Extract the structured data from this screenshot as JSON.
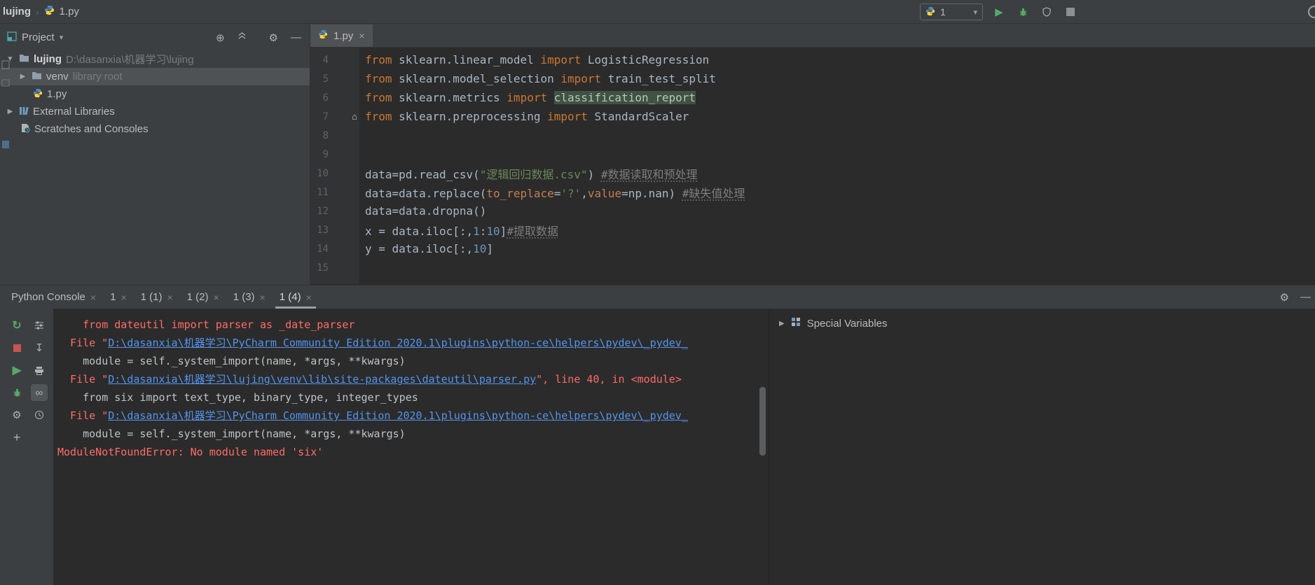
{
  "topbar": {
    "breadcrumb_project": "lujing",
    "breadcrumb_file": "1.py",
    "run_config": "1"
  },
  "icons": {
    "breadcrumb_separator": "›",
    "dropdown_caret": "▾",
    "run": "▶",
    "rerun": "↻",
    "stop": "■",
    "close": "×",
    "expanded": "▼",
    "collapsed": "▶",
    "gear": "⚙",
    "locate": "⊕",
    "minimize": "―",
    "plus": "+",
    "soft_wrap": "∞",
    "scroll_down": "↧",
    "fold_marker": "⌂"
  },
  "project_panel": {
    "title": "Project",
    "tree": {
      "root_label": "lujing",
      "root_path": "D:\\dasanxia\\机器学习\\lujing",
      "venv_label": "venv",
      "venv_suffix": "library root",
      "file_label": "1.py",
      "external_label": "External Libraries",
      "scratches_label": "Scratches and Consoles"
    }
  },
  "editor": {
    "tab_label": "1.py",
    "lines": [
      {
        "num": "4",
        "segments": [
          {
            "c": "kw",
            "t": "from"
          },
          {
            "c": "txt",
            "t": " sklearn.linear_model "
          },
          {
            "c": "kw",
            "t": "import"
          },
          {
            "c": "txt",
            "t": " LogisticRegression"
          }
        ]
      },
      {
        "num": "5",
        "segments": [
          {
            "c": "kw",
            "t": "from"
          },
          {
            "c": "txt",
            "t": " sklearn.model_selection "
          },
          {
            "c": "kw",
            "t": "import"
          },
          {
            "c": "txt",
            "t": " train_test_split"
          }
        ]
      },
      {
        "num": "6",
        "segments": [
          {
            "c": "kw",
            "t": "from"
          },
          {
            "c": "txt",
            "t": " sklearn.metrics "
          },
          {
            "c": "kw",
            "t": "import"
          },
          {
            "c": "txt",
            "t": " "
          },
          {
            "c": "hl",
            "t": "classification_report"
          }
        ]
      },
      {
        "num": "7",
        "marker": true,
        "segments": [
          {
            "c": "kw",
            "t": "from"
          },
          {
            "c": "txt",
            "t": " sklearn.preprocessing "
          },
          {
            "c": "kw",
            "t": "import"
          },
          {
            "c": "txt",
            "t": " StandardScaler"
          }
        ]
      },
      {
        "num": "8",
        "segments": []
      },
      {
        "num": "9",
        "segments": []
      },
      {
        "num": "10",
        "segments": [
          {
            "c": "txt",
            "t": "data=pd.read_csv("
          },
          {
            "c": "str",
            "t": "\"逻辑回归数据.csv\""
          },
          {
            "c": "txt",
            "t": ") "
          },
          {
            "c": "com",
            "t": "#数据读取和预处理"
          }
        ]
      },
      {
        "num": "11",
        "segments": [
          {
            "c": "txt",
            "t": "data=data.replace("
          },
          {
            "c": "arg",
            "t": "to_replace"
          },
          {
            "c": "txt",
            "t": "="
          },
          {
            "c": "str",
            "t": "'?'"
          },
          {
            "c": "txt",
            "t": ","
          },
          {
            "c": "arg",
            "t": "value"
          },
          {
            "c": "txt",
            "t": "=np.nan) "
          },
          {
            "c": "com",
            "t": "#缺失值处理"
          }
        ]
      },
      {
        "num": "12",
        "segments": [
          {
            "c": "txt",
            "t": "data=data.dropna()"
          }
        ]
      },
      {
        "num": "13",
        "segments": [
          {
            "c": "txt",
            "t": "x = data.iloc[:,"
          },
          {
            "c": "num",
            "t": "1"
          },
          {
            "c": "txt",
            "t": ":"
          },
          {
            "c": "num",
            "t": "10"
          },
          {
            "c": "txt",
            "t": "]"
          },
          {
            "c": "com",
            "t": "#提取数据"
          }
        ]
      },
      {
        "num": "14",
        "segments": [
          {
            "c": "txt",
            "t": "y = data.iloc[:,"
          },
          {
            "c": "num",
            "t": "10"
          },
          {
            "c": "txt",
            "t": "]"
          }
        ]
      },
      {
        "num": "15",
        "segments": []
      }
    ]
  },
  "console": {
    "tabs": [
      {
        "label": "Python Console",
        "active": false
      },
      {
        "label": "1",
        "active": false
      },
      {
        "label": "1 (1)",
        "active": false
      },
      {
        "label": "1 (2)",
        "active": false
      },
      {
        "label": "1 (3)",
        "active": false
      },
      {
        "label": "1 (4)",
        "active": true
      }
    ],
    "lines": [
      {
        "segments": [
          {
            "c": "err",
            "t": "    from dateutil import parser as _date_parser"
          }
        ]
      },
      {
        "segments": [
          {
            "c": "err",
            "t": "  File \""
          },
          {
            "c": "link",
            "t": "D:\\dasanxia\\机器学习\\PyCharm Community Edition 2020.1\\plugins\\python-ce\\helpers\\pydev\\_pydev_"
          }
        ]
      },
      {
        "segments": [
          {
            "c": "txt",
            "t": "    module = self._system_import(name, *args, **kwargs)"
          }
        ]
      },
      {
        "segments": [
          {
            "c": "err",
            "t": "  File \""
          },
          {
            "c": "link",
            "t": "D:\\dasanxia\\机器学习\\lujing\\venv\\lib\\site-packages\\dateutil\\parser.py"
          },
          {
            "c": "err",
            "t": "\", line 40, in <module>"
          }
        ]
      },
      {
        "segments": [
          {
            "c": "txt",
            "t": "    from six import text_type, binary_type, integer_types"
          }
        ]
      },
      {
        "segments": [
          {
            "c": "err",
            "t": "  File \""
          },
          {
            "c": "link",
            "t": "D:\\dasanxia\\机器学习\\PyCharm Community Edition 2020.1\\plugins\\python-ce\\helpers\\pydev\\_pydev_"
          }
        ]
      },
      {
        "segments": [
          {
            "c": "txt",
            "t": "    module = self._system_import(name, *args, **kwargs)"
          }
        ]
      },
      {
        "segments": [
          {
            "c": "err",
            "t": "ModuleNotFoundError: No module named 'six'"
          }
        ]
      }
    ]
  },
  "variables_panel": {
    "title": "Special Variables"
  }
}
